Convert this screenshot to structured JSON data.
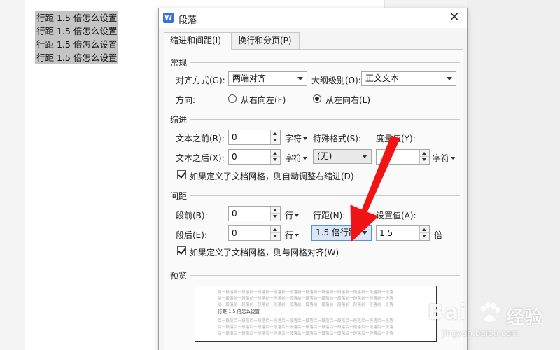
{
  "document": {
    "lines": [
      "行距 1.5 倍怎么设置",
      "行距 1.5 倍怎么设置",
      "行距 1.5 倍怎么设置",
      "行距 1.5 倍怎么设置"
    ]
  },
  "dialog": {
    "title": "段落",
    "app_icon": "W",
    "close_glyph": "✕",
    "tabs": [
      {
        "label": "缩进和间距(I)",
        "active": true
      },
      {
        "label": "换行和分页(P)",
        "active": false
      }
    ]
  },
  "general": {
    "section_title": "常规",
    "alignment_label": "对齐方式(G):",
    "alignment_value": "两端对齐",
    "outline_label": "大纲级别(O):",
    "outline_value": "正文文本",
    "direction_label": "方向:",
    "direction_rtl": "从右向左(F)",
    "direction_ltr": "从左向右(L)",
    "direction_selected": "ltr"
  },
  "indent": {
    "section_title": "缩进",
    "before_label": "文本之前(R):",
    "before_value": "0",
    "before_unit": "字符",
    "after_label": "文本之后(X):",
    "after_value": "0",
    "after_unit": "字符",
    "special_label": "特殊格式(S):",
    "special_value": "(无)",
    "measure_label": "度量值(Y):",
    "measure_value": "",
    "measure_unit": "字符",
    "auto_adjust_label": "如果定义了文档网格，则自动调整右缩进(D)",
    "auto_adjust_checked": true
  },
  "spacing": {
    "section_title": "间距",
    "before_label": "段前(B):",
    "before_value": "0",
    "before_unit": "行",
    "after_label": "段后(E):",
    "after_value": "0",
    "after_unit": "行",
    "line_spacing_label": "行距(N):",
    "line_spacing_value": "1.5 倍行距",
    "setting_label": "设置值(A):",
    "setting_value": "1.5",
    "setting_unit": "倍",
    "snap_grid_label": "如果定义了文档网格，则与网格对齐(W)",
    "snap_grid_checked": true
  },
  "preview": {
    "section_title": "预览",
    "prev_text": "前一段落前一段落前一段落前一段落前一段落前一段落前一段落前一段落前一段落前一段落前一段落",
    "sample_text": "行距 1.5 倍怎么设置",
    "next_text": "后一段落后一段落后一段落后一段落后一段落后一段落后一段落后一段落后一段落后一段落后一段落"
  },
  "watermark": {
    "brand": "Bai",
    "brand_suffix": "经验",
    "url": "jingyan.baidu.com"
  },
  "colors": {
    "arrow": "#f01414",
    "selection": "#c4c4c4",
    "focus": "#dbe7f7"
  }
}
